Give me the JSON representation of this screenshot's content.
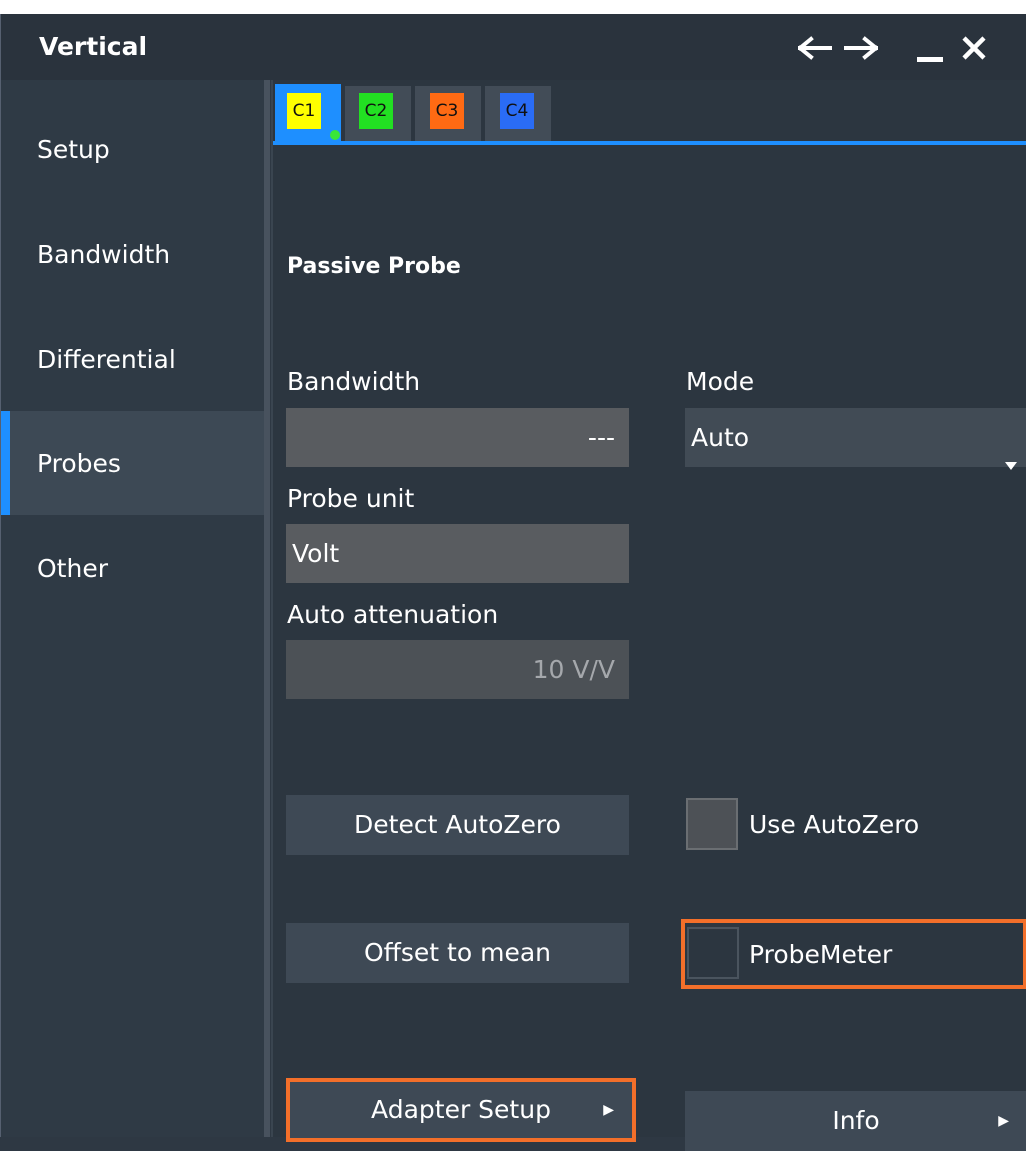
{
  "window": {
    "title": "Vertical",
    "icons": [
      "arrow-left-icon",
      "arrow-right-icon",
      "minimize-icon",
      "close-icon"
    ]
  },
  "sidebar": {
    "items": [
      {
        "label": "Setup"
      },
      {
        "label": "Bandwidth"
      },
      {
        "label": "Differential"
      },
      {
        "label": "Probes",
        "active": true
      },
      {
        "label": "Other"
      }
    ]
  },
  "tabs": [
    {
      "label": "C1",
      "color": "#ffff00",
      "selected": true
    },
    {
      "label": "C2",
      "color": "#22e022"
    },
    {
      "label": "C3",
      "color": "#ff6a13"
    },
    {
      "label": "C4",
      "color": "#2a6cf5"
    }
  ],
  "probe": {
    "section_title": "Passive Probe",
    "bandwidth_label": "Bandwidth",
    "bandwidth_value": "---",
    "mode_label": "Mode",
    "mode_value": "Auto",
    "unit_label": "Probe unit",
    "unit_value": "Volt",
    "atten_label": "Auto attenuation",
    "atten_value": "10 V/V"
  },
  "actions": {
    "detect_autozero": "Detect AutoZero",
    "use_autozero": "Use AutoZero",
    "use_autozero_checked": false,
    "offset_to_mean": "Offset to mean",
    "probemeter": "ProbeMeter",
    "probemeter_checked": false,
    "adapter_setup": "Adapter Setup",
    "info": "Info"
  },
  "colors": {
    "accent": "#1e8fff",
    "highlight": "#f36f2a"
  }
}
